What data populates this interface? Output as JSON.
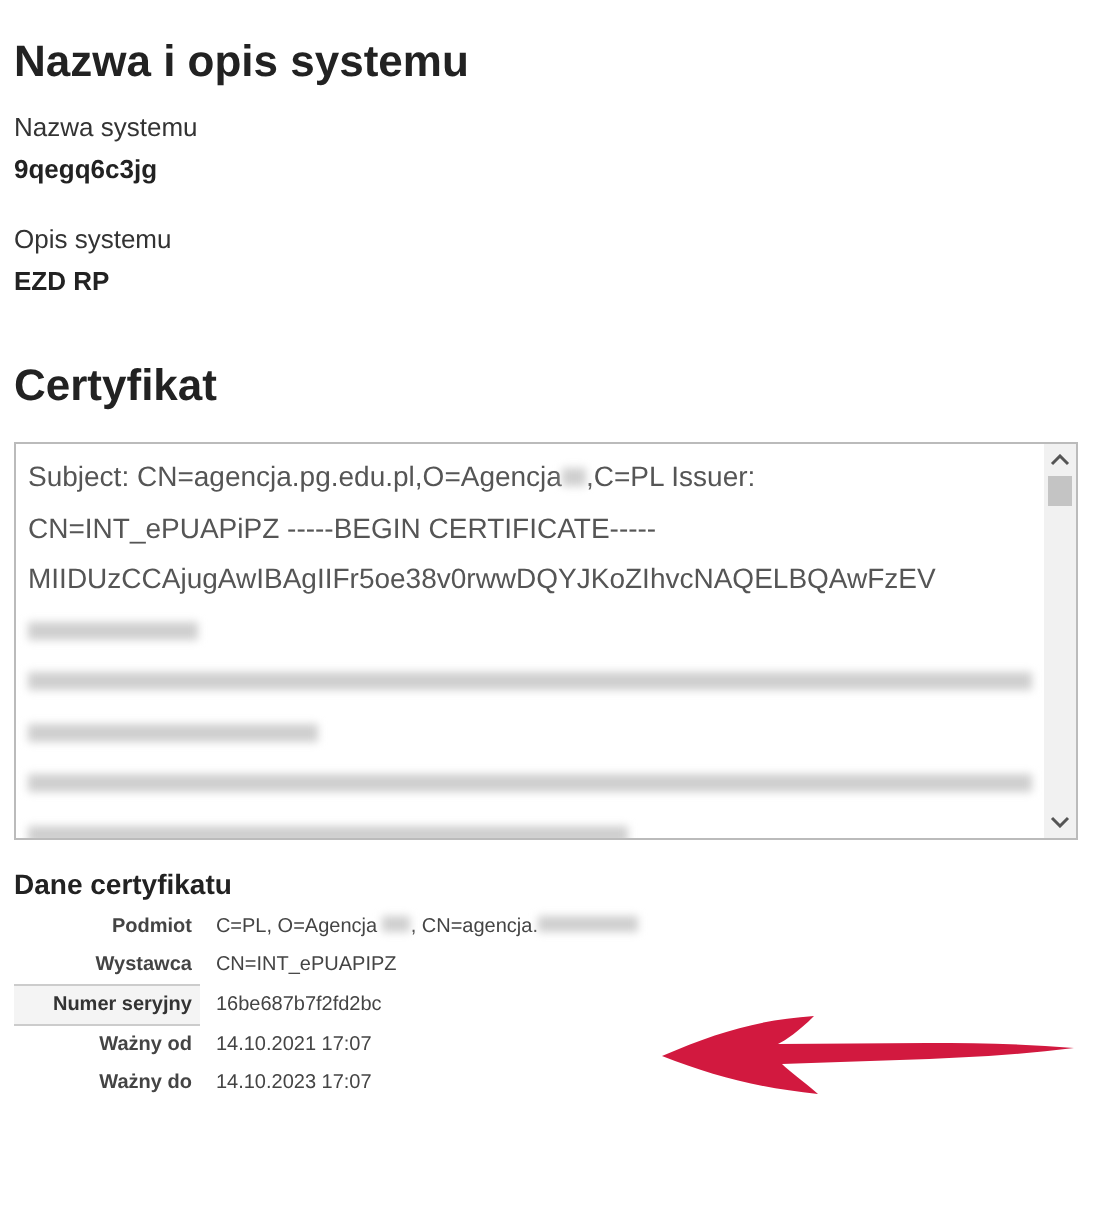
{
  "system": {
    "title": "Nazwa i opis systemu",
    "fields": [
      {
        "label": "Nazwa systemu",
        "value": "9qegq6c3jg"
      },
      {
        "label": "Opis systemu",
        "value": "EZD RP"
      }
    ]
  },
  "certificate": {
    "title": "Certyfikat",
    "lines": [
      [
        {
          "kind": "text",
          "text": "Subject: CN=agencja.pg.edu.pl,O=Agencja "
        },
        {
          "kind": "redacted"
        },
        {
          "kind": "text",
          "text": ",C=PL Issuer:"
        }
      ],
      [
        {
          "kind": "text",
          "text": "CN=INT_ePUAPiPZ -----BEGIN CERTIFICATE-----"
        }
      ],
      [
        {
          "kind": "text",
          "text": "MIIDUzCCAjugAwIBAgIIFr5oe38v0rwwDQYJKoZIhvcNAQELBQAwFzEV"
        }
      ],
      [
        {
          "kind": "redacted"
        }
      ],
      [
        {
          "kind": "redacted"
        }
      ],
      [
        {
          "kind": "redacted"
        }
      ],
      [
        {
          "kind": "redacted"
        }
      ],
      [
        {
          "kind": "redacted"
        }
      ]
    ]
  },
  "details": {
    "title": "Dane certyfikatu",
    "rows": [
      {
        "label": "Podmiot",
        "highlighted": false,
        "parts": [
          {
            "kind": "text",
            "text": "C=PL, O=Agencja "
          },
          {
            "kind": "redacted"
          },
          {
            "kind": "text",
            "text": ", CN=agencja."
          },
          {
            "kind": "redacted"
          }
        ]
      },
      {
        "label": "Wystawca",
        "highlighted": false,
        "parts": [
          {
            "kind": "text",
            "text": "CN=INT_ePUAPIPZ"
          }
        ]
      },
      {
        "label": "Numer seryjny",
        "highlighted": true,
        "parts": [
          {
            "kind": "text",
            "text": "16be687b7f2fd2bc"
          }
        ]
      },
      {
        "label": "Ważny od",
        "highlighted": false,
        "parts": [
          {
            "kind": "text",
            "text": "14.10.2021 17:07"
          }
        ]
      },
      {
        "label": "Ważny do",
        "highlighted": false,
        "parts": [
          {
            "kind": "text",
            "text": "14.10.2023 17:07"
          }
        ]
      }
    ]
  }
}
